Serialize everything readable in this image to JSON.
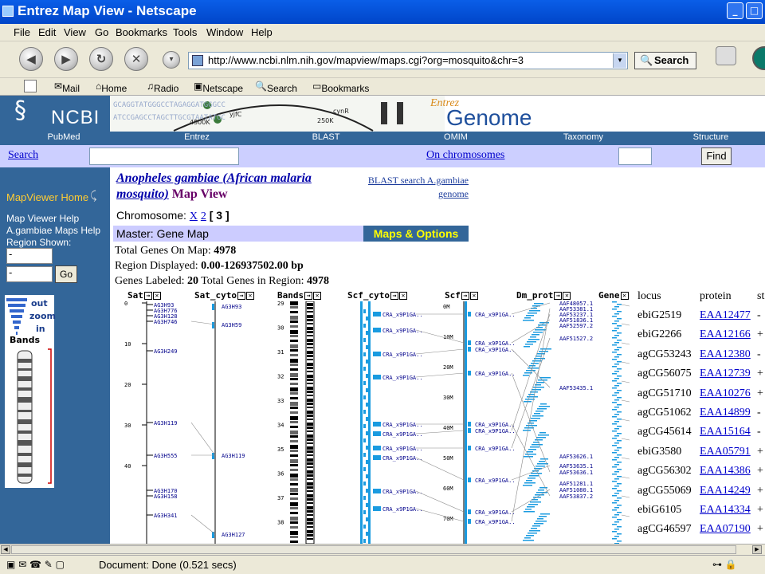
{
  "window": {
    "title": "Entrez Map View - Netscape",
    "btn_min": "_",
    "btn_max": "□",
    "btn_close": "✕"
  },
  "menu": [
    "File",
    "Edit",
    "View",
    "Go",
    "Bookmarks",
    "Tools",
    "Window",
    "Help"
  ],
  "nav": {
    "url": "http://www.ncbi.nlm.nih.gov/mapview/maps.cgi?org=mosquito&chr=3",
    "search_button": "Search"
  },
  "personal": {
    "mail": "Mail",
    "home": "Home",
    "radio": "Radio",
    "netscape": "Netscape",
    "search": "Search",
    "bookmarks": "Bookmarks"
  },
  "banner": {
    "ncbi": "NCBI",
    "entrez": "Entrez",
    "genome": "Genome"
  },
  "tabs": [
    "PubMed",
    "Entrez",
    "BLAST",
    "OMIM",
    "Taxonomy",
    "Structure"
  ],
  "searchrow": {
    "search_label": "Search",
    "on_chromosomes": "On chromosomes",
    "find_button": "Find"
  },
  "sidebar": {
    "mapviewer_home": "MapViewer Home",
    "help1": "Map Viewer Help",
    "help2": "A.gambiae Maps Help",
    "region_shown": "Region Shown:",
    "go_button": "Go",
    "zoom_out": "out",
    "zoom_zoom": "zoom",
    "zoom_in": "in",
    "bands": "Bands"
  },
  "main": {
    "species": "Anopheles gambiae (African malaria mosquito)",
    "map_view": "Map View",
    "blast_link": "BLAST search A.gambiae genome",
    "chromosome_label": "Chromosome:",
    "chrom_x": "X",
    "chrom_2": "2",
    "chrom_current": "[ 3 ]",
    "master": "Master: Gene Map",
    "maps_options": "Maps & Options",
    "total_genes_label": "Total Genes On Map:",
    "total_genes": "4978",
    "region_label": "Region Displayed:",
    "region": "0.00-126937502.00 bp",
    "labeled_label": "Genes Labeled:",
    "labeled": "20",
    "total_region_label": "Total Genes in Region:",
    "total_region": "4978"
  },
  "columns": [
    "Sat",
    "Sat_cyto",
    "Bands",
    "Scf_cyto",
    "Scf",
    "Dm_prot",
    "Gene"
  ],
  "sat_ticks": [
    "0",
    "10",
    "20",
    "30",
    "40"
  ],
  "sat_labels": [
    "AG3H93",
    "AG3H776",
    "AG3H128",
    "AG3H746",
    "AG3H249",
    "AG3H119",
    "AG3H555",
    "AG3H170",
    "AG3H158",
    "AG3H341"
  ],
  "satcyto_labels": [
    "AG3H93",
    "AG3H59",
    "AG3H119",
    "AG3H127"
  ],
  "band_ticks": [
    "29",
    "30",
    "31",
    "32",
    "33",
    "34",
    "35",
    "36",
    "37",
    "38"
  ],
  "scf_ticks": [
    "0M",
    "10M",
    "20M",
    "30M",
    "40M",
    "50M",
    "60M",
    "70M"
  ],
  "cra_labels": [
    "CRA_x9P1GA..",
    "CRA_x9P1GA..",
    "CRA_x9P1GA..",
    "CRA_x9P1GA..",
    "CRA_x9P1GA..",
    "CRA_x9P1GA..",
    "CRA_x9P1GA..",
    "CRA_x9P1GA..",
    "CRA_x9P1GA..",
    "CRA_x9P1GA.."
  ],
  "scf_labels": [
    "CRA_x9P1GA..",
    "CRA_x9P1GA..",
    "CRA_x9P1GA..",
    "CRA_x9P1GA..",
    "CRA_x9P1GA..",
    "CRA_x9P1GA..",
    "CRA_x9P1GA..",
    "CRA_x9P1GA..",
    "CRA_x9P1GA..",
    "CRA_x9P1GA.."
  ],
  "aaf_labels": [
    "AAF48057.1",
    "AAF53381.1",
    "AAF53237.1",
    "AAF51836.1",
    "AAF52597.2",
    "AAF51527.2",
    "AAF53435.1",
    "AAF53626.1",
    "AAF53635.1",
    "AAF53636.1",
    "AAF51281.1",
    "AAF51080.1",
    "AAF53837.2"
  ],
  "gene_table": {
    "headers": [
      "locus",
      "protein",
      "st"
    ],
    "rows": [
      {
        "locus": "ebiG2519",
        "protein": "EAA12477",
        "strand": "-"
      },
      {
        "locus": "ebiG2266",
        "protein": "EAA12166",
        "strand": "+"
      },
      {
        "locus": "agCG53243",
        "protein": "EAA12380",
        "strand": "-"
      },
      {
        "locus": "agCG56075",
        "protein": "EAA12739",
        "strand": "+"
      },
      {
        "locus": "agCG51710",
        "protein": "EAA10276",
        "strand": "+"
      },
      {
        "locus": "agCG51062",
        "protein": "EAA14899",
        "strand": "-"
      },
      {
        "locus": "agCG45614",
        "protein": "EAA15164",
        "strand": "-"
      },
      {
        "locus": "ebiG3580",
        "protein": "EAA05791",
        "strand": "+"
      },
      {
        "locus": "agCG56302",
        "protein": "EAA14386",
        "strand": "+"
      },
      {
        "locus": "agCG55069",
        "protein": "EAA14249",
        "strand": "+"
      },
      {
        "locus": "ebiG6105",
        "protein": "EAA14334",
        "strand": "+"
      },
      {
        "locus": "agCG46597",
        "protein": "EAA07190",
        "strand": "+"
      }
    ]
  },
  "status": {
    "text": "Document: Done (0.521 secs)"
  },
  "colors": {
    "ncbi_blue": "#336699",
    "tab_lavender": "#cccfff",
    "map_blue": "#1a9be0",
    "maps_options_bg": "#336699",
    "maps_options_text": "#ffff00"
  }
}
